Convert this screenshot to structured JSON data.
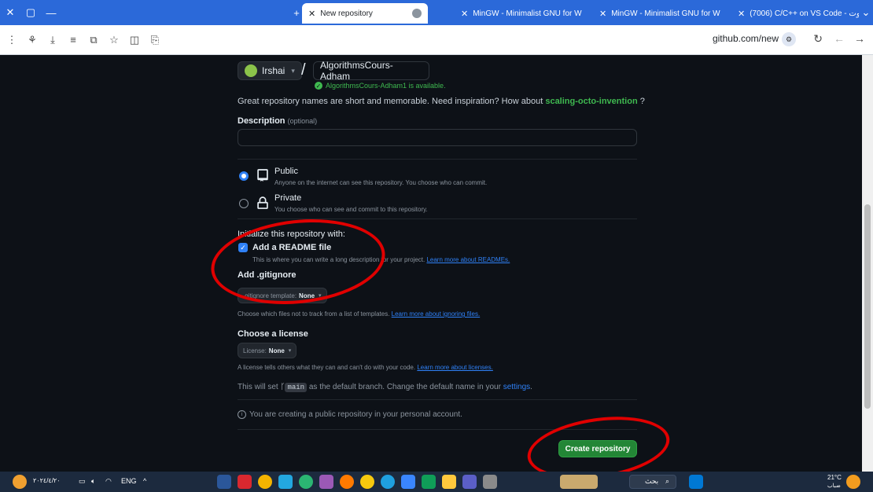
{
  "browser": {
    "tabs": [
      {
        "label": "New repository",
        "active": true
      },
      {
        "label": "MinGW - Minimalist GNU for W"
      },
      {
        "label": "MinGW - Minimalist GNU for W"
      },
      {
        "label": "(7006) C/C++ on VS Code - يوت"
      }
    ],
    "new_tab": "+",
    "url": "github.com/new"
  },
  "form": {
    "owner": "Irshai",
    "owner_caret": "▾",
    "slash": "/",
    "repo_name": "AlgorithmsCours-Adham",
    "availability": "AlgorithmsCours-Adham1 is available.",
    "suggest_prefix": "Great repository names are short and memorable. Need inspiration? How about",
    "suggest_name": "scaling-octo-invention",
    "suggest_suffix": "?",
    "description_label": "Description",
    "description_optional": "(optional)",
    "public_title": "Public",
    "public_sub": "Anyone on the internet can see this repository. You choose who can commit.",
    "private_title": "Private",
    "private_sub": "You choose who can see and commit to this repository.",
    "init_label": "Initialize this repository with:",
    "readme_label": "Add a README file",
    "readme_sub_prefix": "This is where you can write a long description for your project.",
    "readme_link": "Learn more about READMEs.",
    "gitignore_label": "Add .gitignore",
    "gitignore_drop_prefix": ".gitignore template:",
    "gitignore_drop_value": "None",
    "gitignore_sub_prefix": "Choose which files not to track from a list of templates.",
    "gitignore_link": "Learn more about ignoring files.",
    "license_label": "Choose a license",
    "license_drop_prefix": "License:",
    "license_drop_value": "None",
    "license_sub_prefix": "A license tells others what they can and can't do with your code.",
    "license_link": "Learn more about licenses.",
    "branch_prefix": "This will set",
    "branch_name": "main",
    "branch_mid": "as the default branch. Change the default name in your",
    "branch_link": "settings",
    "note": "You are creating a public repository in your personal account.",
    "create_button": "Create repository"
  },
  "taskbar": {
    "search_label": "بحث",
    "lang": "ENG",
    "weather": "21°C",
    "weather_sub": "ضباب",
    "clock": "٢٠٢٤/٤/٢٠"
  },
  "colors": {
    "accent": "#2f81f7",
    "success": "#238636",
    "annotation": "#e00000"
  }
}
